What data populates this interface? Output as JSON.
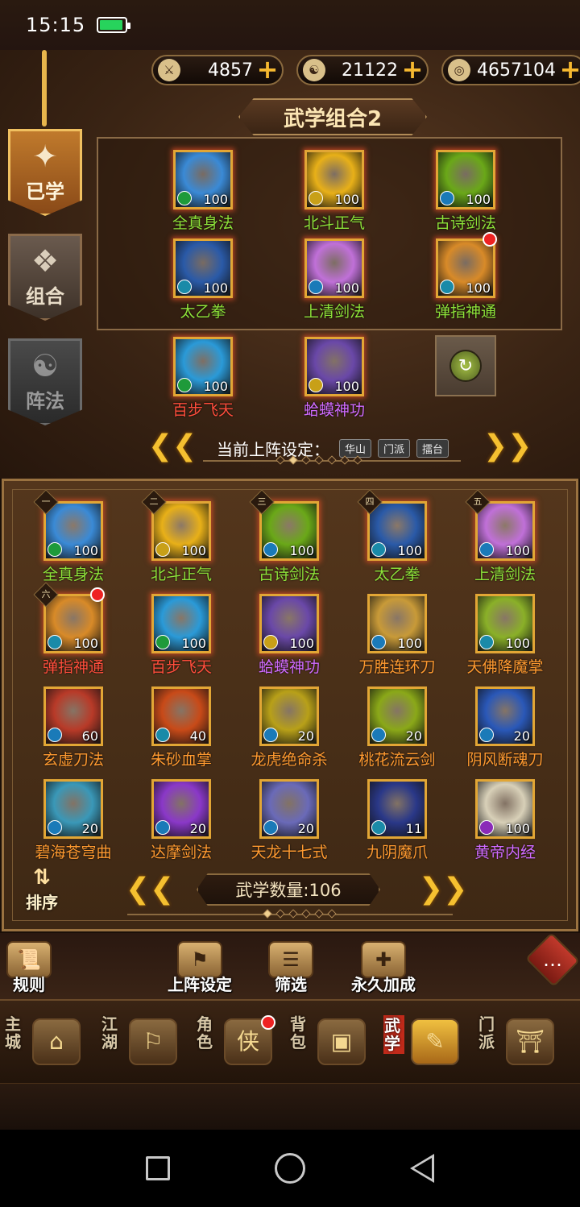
{
  "status": {
    "time": "15:15"
  },
  "currency": [
    {
      "icon": "sword-cross-icon",
      "glyph": "⚔",
      "value": "4857"
    },
    {
      "icon": "taiji-coin-icon",
      "glyph": "☯",
      "value": "21122"
    },
    {
      "icon": "silver-coin-icon",
      "glyph": "◎",
      "value": "4657104"
    }
  ],
  "side_tabs": [
    {
      "label": "已学",
      "glyph": "✦",
      "state": "active"
    },
    {
      "label": "组合",
      "glyph": "❖",
      "state": "normal"
    },
    {
      "label": "阵法",
      "glyph": "☯",
      "state": "inactive"
    }
  ],
  "combo": {
    "title": "武学组合2",
    "slots": [
      {
        "name": "全真身法",
        "level": "100",
        "color": "green",
        "icon_color": "#3a8ad6",
        "badge": "#1e9a3a"
      },
      {
        "name": "北斗正气",
        "level": "100",
        "color": "green",
        "icon_color": "#e8b018",
        "badge": "#c8a018"
      },
      {
        "name": "古诗剑法",
        "level": "100",
        "color": "green",
        "icon_color": "#6aa818",
        "badge": "#1a7ab8"
      },
      {
        "name": "太乙拳",
        "level": "100",
        "color": "green",
        "icon_color": "#2a5aa8",
        "badge": "#1a8aa8"
      },
      {
        "name": "上清剑法",
        "level": "100",
        "color": "green",
        "icon_color": "#c070d8",
        "badge": "#1a7ab8"
      },
      {
        "name": "弹指神通",
        "level": "100",
        "color": "green",
        "icon_color": "#d88a28",
        "badge": "#1a8aa8",
        "dot": true
      },
      {
        "name": "百步飞天",
        "level": "100",
        "color": "red",
        "icon_color": "#2a9ad8",
        "badge": "#1e9a3a"
      },
      {
        "name": "蛤蟆神功",
        "level": "100",
        "color": "purple",
        "icon_color": "#6a48a8",
        "badge": "#c8a018"
      }
    ],
    "formation_label": "当前上阵设定：",
    "formation_tags": [
      "华山",
      "门派",
      "擂台"
    ]
  },
  "collection": {
    "items": [
      {
        "name": "全真身法",
        "level": "100",
        "color": "green",
        "icon_color": "#3a8ad6",
        "badge": "#1e9a3a",
        "rank": "一"
      },
      {
        "name": "北斗正气",
        "level": "100",
        "color": "green",
        "icon_color": "#e8b018",
        "badge": "#c8a018",
        "rank": "二"
      },
      {
        "name": "古诗剑法",
        "level": "100",
        "color": "green",
        "icon_color": "#6aa818",
        "badge": "#1a7ab8",
        "rank": "三"
      },
      {
        "name": "太乙拳",
        "level": "100",
        "color": "green",
        "icon_color": "#2a5aa8",
        "badge": "#1a8aa8",
        "rank": "四"
      },
      {
        "name": "上清剑法",
        "level": "100",
        "color": "green",
        "icon_color": "#c070d8",
        "badge": "#1a7ab8",
        "rank": "五"
      },
      {
        "name": "弹指神通",
        "level": "100",
        "color": "red",
        "icon_color": "#d88a28",
        "badge": "#1a8aa8",
        "rank": "六",
        "dot": true
      },
      {
        "name": "百步飞天",
        "level": "100",
        "color": "red",
        "icon_color": "#2a9ad8",
        "badge": "#1e9a3a"
      },
      {
        "name": "蛤蟆神功",
        "level": "100",
        "color": "purple",
        "icon_color": "#6a48a8",
        "badge": "#c8a018"
      },
      {
        "name": "万胜连环刀",
        "level": "100",
        "color": "orange",
        "icon_color": "#c89a38",
        "badge": "#1a7ab8"
      },
      {
        "name": "天佛降魔掌",
        "level": "100",
        "color": "orange",
        "icon_color": "#8ab028",
        "badge": "#1a8aa8"
      },
      {
        "name": "玄虚刀法",
        "level": "60",
        "color": "orange",
        "icon_color": "#b83a28",
        "badge": "#1a7ab8"
      },
      {
        "name": "朱砂血掌",
        "level": "40",
        "color": "orange",
        "icon_color": "#c84a18",
        "badge": "#1a8aa8"
      },
      {
        "name": "龙虎绝命杀",
        "level": "20",
        "color": "orange",
        "icon_color": "#b8a018",
        "badge": "#1a7ab8"
      },
      {
        "name": "桃花流云剑",
        "level": "20",
        "color": "orange",
        "icon_color": "#8aa818",
        "badge": "#1a7ab8"
      },
      {
        "name": "阴风断魂刀",
        "level": "20",
        "color": "orange",
        "icon_color": "#2a58b8",
        "badge": "#1a7ab8"
      },
      {
        "name": "碧海苍穹曲",
        "level": "20",
        "color": "orange",
        "icon_color": "#3a98b8",
        "badge": "#1a7ab8"
      },
      {
        "name": "达摩剑法",
        "level": "20",
        "color": "orange",
        "icon_color": "#8a38c8",
        "badge": "#1a7ab8"
      },
      {
        "name": "天龙十七式",
        "level": "20",
        "color": "orange",
        "icon_color": "#6a6ab8",
        "badge": "#1a7ab8"
      },
      {
        "name": "九阴魔爪",
        "level": "11",
        "color": "orange",
        "icon_color": "#2a3888",
        "badge": "#1a8aa8"
      },
      {
        "name": "黄帝内经",
        "level": "100",
        "color": "purple",
        "icon_color": "#d8d0b8",
        "badge": "#8a2ab8"
      }
    ],
    "sort_label": "排序",
    "count_label": "武学数量:106"
  },
  "actions": [
    {
      "label": "规则",
      "glyph": "📜"
    },
    {
      "label": "上阵设定",
      "glyph": "⚑"
    },
    {
      "label": "筛选",
      "glyph": "☰"
    },
    {
      "label": "永久加成",
      "glyph": "✚"
    }
  ],
  "chat_icon": "chat-bubble-icon",
  "nav": [
    {
      "label": "主城",
      "glyph": "⌂"
    },
    {
      "label": "江湖",
      "glyph": "⚐"
    },
    {
      "label": "角色",
      "glyph": "侠",
      "dot": true
    },
    {
      "label": "背包",
      "glyph": "▣"
    },
    {
      "label": "武学",
      "glyph": "✎",
      "active": true
    },
    {
      "label": "门派",
      "glyph": "⛩"
    }
  ]
}
